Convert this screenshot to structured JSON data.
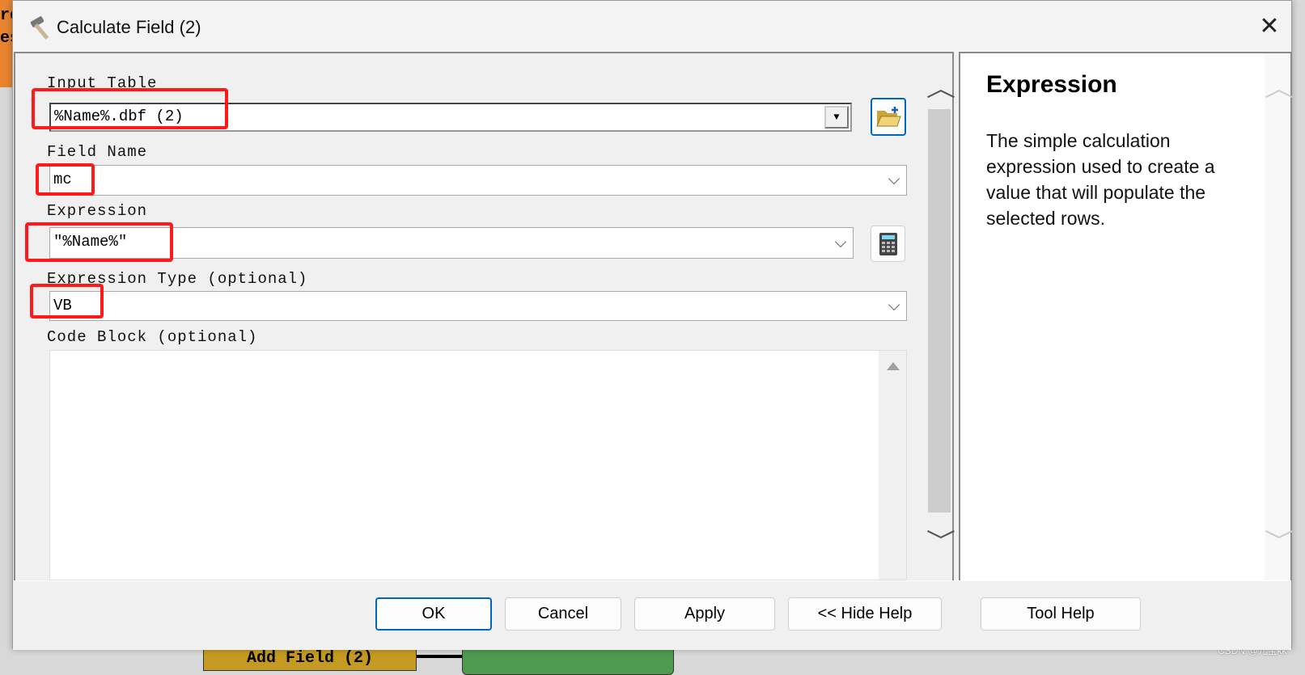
{
  "window": {
    "title": "Calculate Field (2)"
  },
  "form": {
    "input_table": {
      "label": "Input Table",
      "value": "%Name%.dbf (2)"
    },
    "field_name": {
      "label": "Field Name",
      "value": "mc"
    },
    "expression": {
      "label": "Expression",
      "value": "\"%Name%\""
    },
    "expression_type": {
      "label": "Expression Type (optional)",
      "value": "VB"
    },
    "code_block": {
      "label": "Code Block (optional)",
      "value": ""
    }
  },
  "help": {
    "title": "Expression",
    "body": "The simple calculation expression used to create a value that will populate the selected rows."
  },
  "buttons": {
    "ok": "OK",
    "cancel": "Cancel",
    "apply": "Apply",
    "hide_help": "<< Hide Help",
    "tool_help": "Tool Help"
  },
  "background": {
    "left_text_1": "re",
    "left_text_2": "es",
    "model_box": "Add Field (2)",
    "watermark": "CSDN @元宝kk"
  },
  "colors": {
    "highlight": "#ff1a1a",
    "focus": "#0067c0"
  }
}
